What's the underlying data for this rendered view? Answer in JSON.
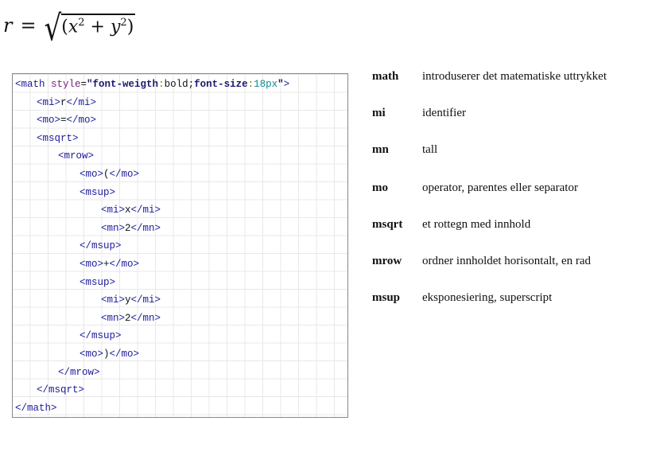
{
  "formula": {
    "lhs": "r",
    "eq": "=",
    "radical": "√",
    "open": "(",
    "x": "x",
    "two": "2",
    "plus": " + ",
    "y": "y",
    "close": ")"
  },
  "code_lines": [
    {
      "indent": 0,
      "parts": [
        [
          "tag",
          "<math "
        ],
        [
          "attr",
          "style"
        ],
        [
          "txt",
          "="
        ],
        [
          "str",
          "\"font-weigth"
        ],
        [
          "punct",
          ":"
        ],
        [
          "txt",
          "bold;"
        ],
        [
          "str",
          "font-size"
        ],
        [
          "punct",
          ":"
        ],
        [
          "num",
          "18px"
        ],
        [
          "str",
          "\""
        ],
        [
          "tag",
          ">"
        ]
      ]
    },
    {
      "indent": 1,
      "parts": [
        [
          "tag",
          "<mi>"
        ],
        [
          "txt",
          "r"
        ],
        [
          "tag",
          "</mi>"
        ]
      ]
    },
    {
      "indent": 1,
      "parts": [
        [
          "tag",
          "<mo>"
        ],
        [
          "txt",
          "="
        ],
        [
          "tag",
          "</mo>"
        ]
      ]
    },
    {
      "indent": 1,
      "parts": [
        [
          "tag",
          "<msqrt>"
        ]
      ]
    },
    {
      "indent": 2,
      "parts": [
        [
          "tag",
          "<mrow>"
        ]
      ]
    },
    {
      "indent": 3,
      "parts": [
        [
          "tag",
          "<mo>"
        ],
        [
          "txt",
          "("
        ],
        [
          "tag",
          "</mo>"
        ]
      ]
    },
    {
      "indent": 3,
      "parts": [
        [
          "tag",
          "<msup>"
        ]
      ]
    },
    {
      "indent": 4,
      "parts": [
        [
          "tag",
          "<mi>"
        ],
        [
          "txt",
          "x"
        ],
        [
          "tag",
          "</mi>"
        ]
      ]
    },
    {
      "indent": 4,
      "parts": [
        [
          "tag",
          "<mn>"
        ],
        [
          "txt",
          "2"
        ],
        [
          "tag",
          "</mn>"
        ]
      ]
    },
    {
      "indent": 3,
      "parts": [
        [
          "tag",
          "</msup>"
        ]
      ]
    },
    {
      "indent": 3,
      "parts": [
        [
          "tag",
          "<mo>"
        ],
        [
          "txt",
          "+"
        ],
        [
          "tag",
          "</mo>"
        ]
      ]
    },
    {
      "indent": 3,
      "parts": [
        [
          "tag",
          "<msup>"
        ]
      ]
    },
    {
      "indent": 4,
      "parts": [
        [
          "tag",
          "<mi>"
        ],
        [
          "txt",
          "y"
        ],
        [
          "tag",
          "</mi>"
        ]
      ]
    },
    {
      "indent": 4,
      "parts": [
        [
          "tag",
          "<mn>"
        ],
        [
          "txt",
          "2"
        ],
        [
          "tag",
          "</mn>"
        ]
      ]
    },
    {
      "indent": 3,
      "parts": [
        [
          "tag",
          "</msup>"
        ]
      ]
    },
    {
      "indent": 3,
      "parts": [
        [
          "tag",
          "<mo>"
        ],
        [
          "txt",
          ")"
        ],
        [
          "tag",
          "</mo>"
        ]
      ]
    },
    {
      "indent": 2,
      "parts": [
        [
          "tag",
          "</mrow>"
        ]
      ]
    },
    {
      "indent": 1,
      "parts": [
        [
          "tag",
          "</msqrt>"
        ]
      ]
    },
    {
      "indent": 0,
      "parts": [
        [
          "tag",
          "</math>"
        ]
      ]
    }
  ],
  "definitions": [
    {
      "term": "math",
      "desc": "introduserer det matematiske uttrykket"
    },
    {
      "term": "mi",
      "desc": "identifier"
    },
    {
      "term": "mn",
      "desc": "tall"
    },
    {
      "term": "mo",
      "desc": "operator, parentes eller separator"
    },
    {
      "term": "msqrt",
      "desc": "et rottegn med innhold"
    },
    {
      "term": "mrow",
      "desc": "ordner innholdet horisontalt, en rad"
    },
    {
      "term": "msup",
      "desc": "eksponesiering, superscript"
    }
  ]
}
